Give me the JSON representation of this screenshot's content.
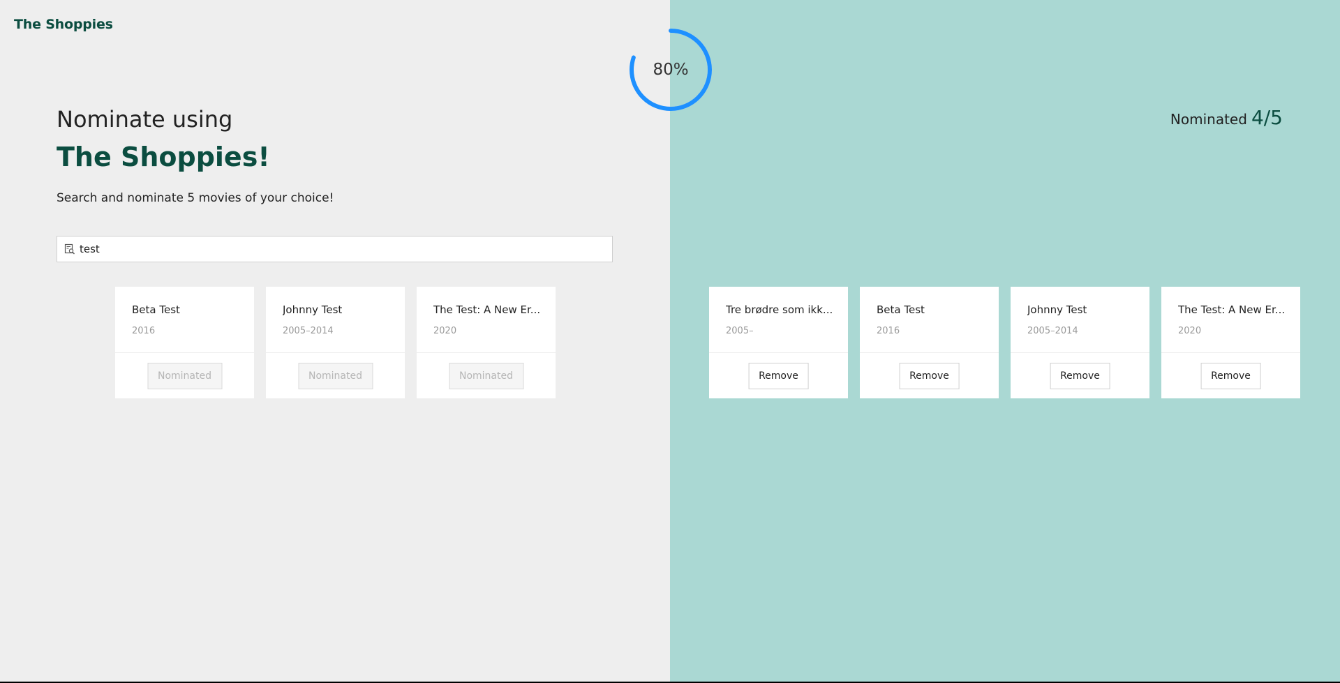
{
  "header": {
    "logo": "The Shoppies"
  },
  "intro": {
    "heading_line1": "Nominate using",
    "heading_line2": "The Shoppies!",
    "subtitle": "Search and nominate 5 movies of your choice!"
  },
  "search": {
    "value": "test",
    "icon": "search-icon"
  },
  "progress": {
    "percent_label": "80%",
    "value": 0.8,
    "color": "#1e90ff",
    "track_color": "#eeeeee"
  },
  "nominated": {
    "label": "Nominated",
    "count": "4/5"
  },
  "results": [
    {
      "title": "Beta Test",
      "year": "2016",
      "button": "Nominated"
    },
    {
      "title": "Johnny Test",
      "year": "2005–2014",
      "button": "Nominated"
    },
    {
      "title": "The Test: A New Er...",
      "year": "2020",
      "button": "Nominated"
    }
  ],
  "nominations": [
    {
      "title": "Tre brødre som ikk...",
      "year": "2005–",
      "button": "Remove"
    },
    {
      "title": "Beta Test",
      "year": "2016",
      "button": "Remove"
    },
    {
      "title": "Johnny Test",
      "year": "2005–2014",
      "button": "Remove"
    },
    {
      "title": "The Test: A New Er...",
      "year": "2020",
      "button": "Remove"
    }
  ],
  "colors": {
    "left_bg": "#eeeeee",
    "right_bg": "#aad8d3",
    "brand": "#0b4d40"
  }
}
